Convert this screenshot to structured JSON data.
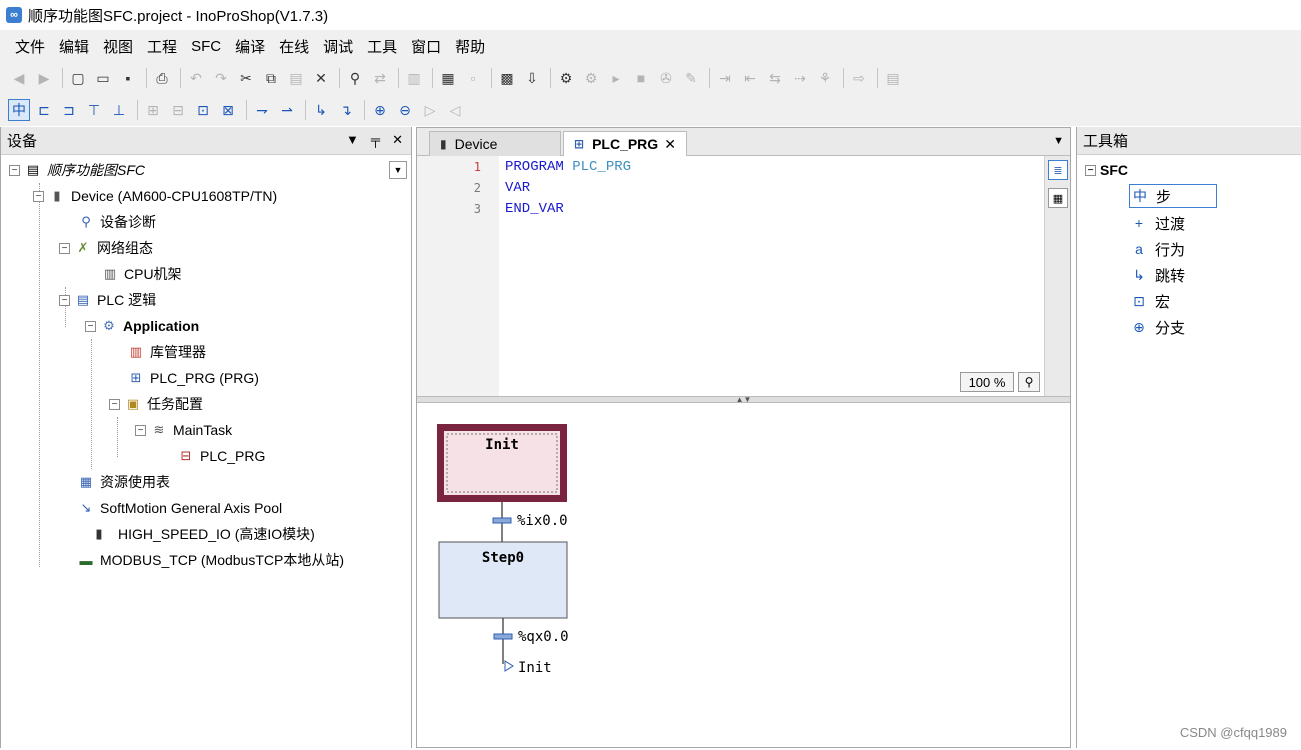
{
  "window": {
    "title": "顺序功能图SFC.project - InoProShop(V1.7.3)",
    "app_icon_glyph": "∞"
  },
  "menu": [
    "文件",
    "编辑",
    "视图",
    "工程",
    "SFC",
    "编译",
    "在线",
    "调试",
    "工具",
    "窗口",
    "帮助"
  ],
  "devices_pane": {
    "title": "设备",
    "header_buttons": [
      "▼",
      "╤",
      "✕"
    ],
    "tree": {
      "root": "顺序功能图SFC",
      "device": "Device (AM600-CPU1608TP/TN)",
      "diag": "设备诊断",
      "network": "网络组态",
      "cpu_rack": "CPU机架",
      "plc_logic": "PLC 逻辑",
      "application": "Application",
      "library": "库管理器",
      "plc_prg": "PLC_PRG (PRG)",
      "task_config": "任务配置",
      "main_task": "MainTask",
      "task_plc_prg": "PLC_PRG",
      "resource": "资源使用表",
      "softmotion": "SoftMotion General Axis Pool",
      "high_speed": "HIGH_SPEED_IO (高速IO模块)",
      "modbus": "MODBUS_TCP (ModbusTCP本地从站)"
    }
  },
  "editor": {
    "tabs": [
      {
        "label": "Device"
      },
      {
        "label": "PLC_PRG"
      }
    ],
    "declaration": {
      "line_numbers": [
        "1",
        "2",
        "3"
      ],
      "kw_program": "PROGRAM",
      "ident_program": "PLC_PRG",
      "kw_var": "VAR",
      "kw_end_var": "END_VAR"
    },
    "zoom": "100 %",
    "sfc": {
      "init_step": "Init",
      "transition1": "%ix0.0",
      "step0": "Step0",
      "transition2": "%qx0.0",
      "jump_target": "Init"
    }
  },
  "toolbox": {
    "title": "工具箱",
    "category": "SFC",
    "items": [
      {
        "label": "步",
        "icon": "中"
      },
      {
        "label": "过渡",
        "icon": "+"
      },
      {
        "label": "行为",
        "icon": "a"
      },
      {
        "label": "跳转",
        "icon": "↳"
      },
      {
        "label": "宏",
        "icon": "⊡"
      },
      {
        "label": "分支",
        "icon": "⊕"
      }
    ]
  },
  "watermark": "CSDN @cfqq1989",
  "colors": {
    "init_step_border": "#7a2540",
    "init_step_fill": "#f6e1e6",
    "step_fill": "#dfe8f6",
    "keyword": "#1a1acc"
  }
}
